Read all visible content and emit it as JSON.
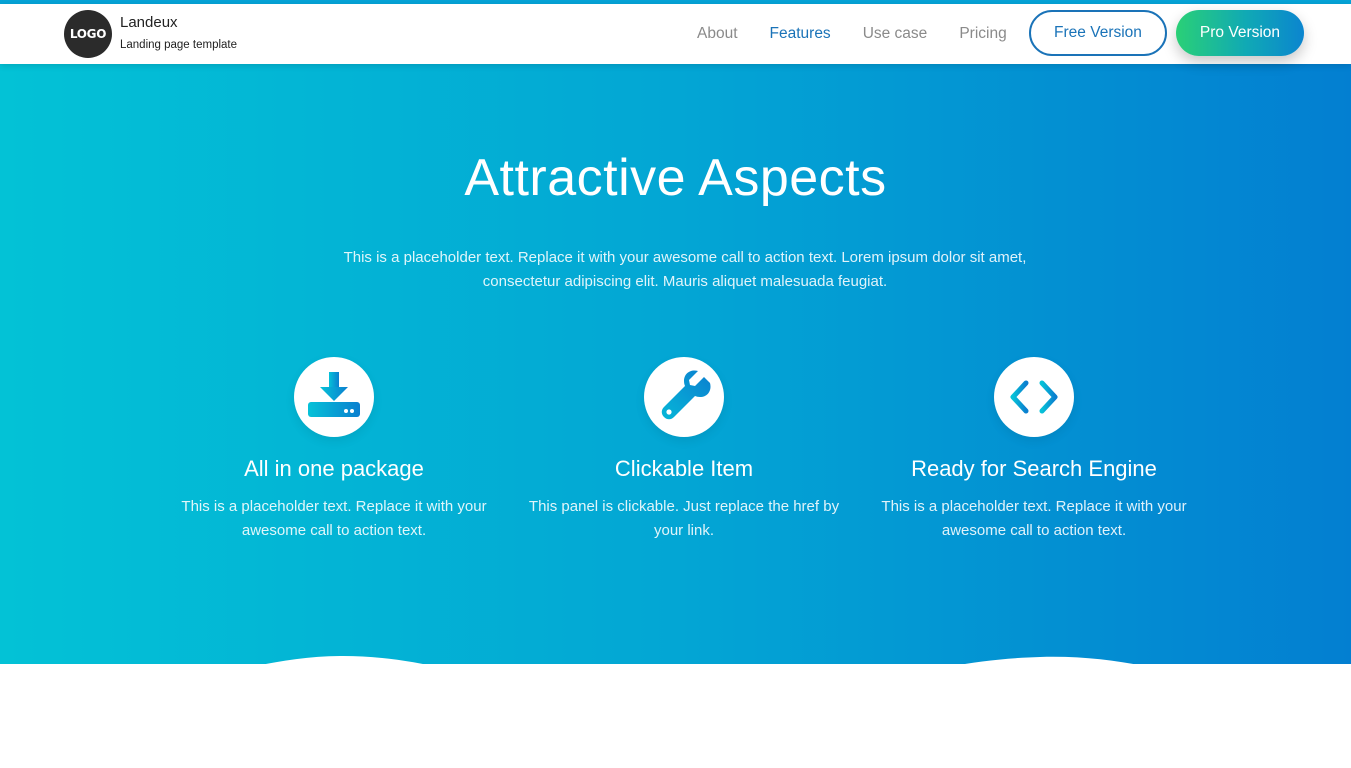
{
  "brand": {
    "logo_text": "LOGO",
    "name": "Landeux",
    "tagline": "Landing page template"
  },
  "nav": {
    "items": [
      {
        "label": "About",
        "active": false
      },
      {
        "label": "Features",
        "active": true
      },
      {
        "label": "Use case",
        "active": false
      },
      {
        "label": "Pricing",
        "active": false
      }
    ],
    "free_button": "Free Version",
    "pro_button": "Pro Version"
  },
  "hero": {
    "title": "Attractive Aspects",
    "description": "This is a placeholder text. Replace it with your awesome call to action text. Lorem ipsum dolor sit amet, consectetur adipiscing elit. Mauris aliquet malesuada feugiat."
  },
  "features": [
    {
      "icon": "download-icon",
      "title": "All in one package",
      "description": "This is a placeholder text. Replace it with your awesome call to action text."
    },
    {
      "icon": "wrench-icon",
      "title": "Clickable Item",
      "description": "This panel is clickable. Just replace the href by your link."
    },
    {
      "icon": "code-icon",
      "title": "Ready for Search Engine",
      "description": "This is a placeholder text. Replace it with your awesome call to action text."
    }
  ],
  "colors": {
    "accent": "#1a73b8",
    "hero_start": "#03c2d6",
    "hero_end": "#037fd1",
    "pro_start": "#2ad076",
    "pro_end": "#0b85cf"
  }
}
